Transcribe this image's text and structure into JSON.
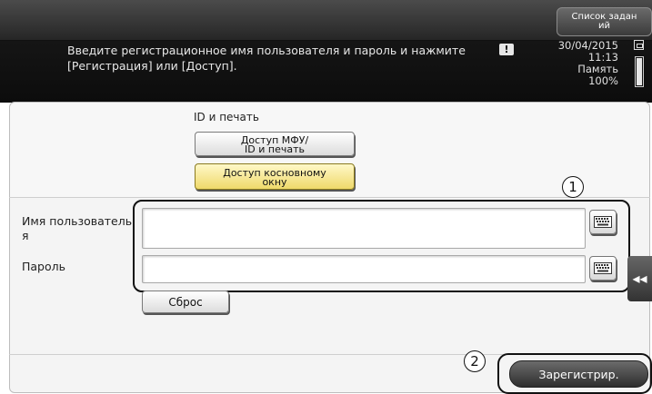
{
  "header": {
    "job_list_label": "Список задан\nий",
    "message": "Введите регистрационное имя пользователя и пароль и нажмите [Регистрация] или [Доступ].",
    "warning_symbol": "!",
    "date": "30/04/2015",
    "time": "11:13",
    "memory_label": "Память",
    "memory_value": "100%",
    "memory_fraction": 1.0
  },
  "auth": {
    "title": "ID и печать",
    "mfp_access_label": "Доступ МФУ/\nID и печать",
    "touch_access_label": "Доступ косновному\nокну"
  },
  "form": {
    "user_label": "Имя пользователь\nя",
    "user_value": "",
    "password_label": "Пароль",
    "password_value": "",
    "reset_label": "Сброс"
  },
  "callouts": {
    "one": "1",
    "two": "2"
  },
  "footer": {
    "register_label": "Зарегистрир.",
    "side_tab_label": "◂◂"
  },
  "colors": {
    "touch_access_bg": "#efd96a",
    "header_bg": "#161616"
  }
}
